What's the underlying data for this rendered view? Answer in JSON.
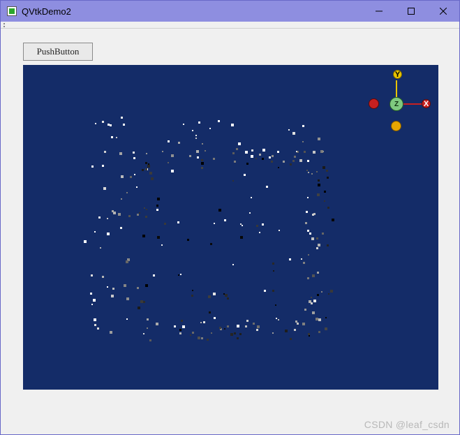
{
  "window": {
    "title": "QVtkDemo2"
  },
  "toolbar": {
    "push_button_label": "PushButton"
  },
  "triaxis": {
    "x_label": "X",
    "y_label": "Y",
    "z_label": "Z"
  },
  "watermark": "CSDN @leaf_csdn",
  "viewport": {
    "bg_color": "#142c68"
  },
  "points_seed": 17,
  "points_count": 260
}
